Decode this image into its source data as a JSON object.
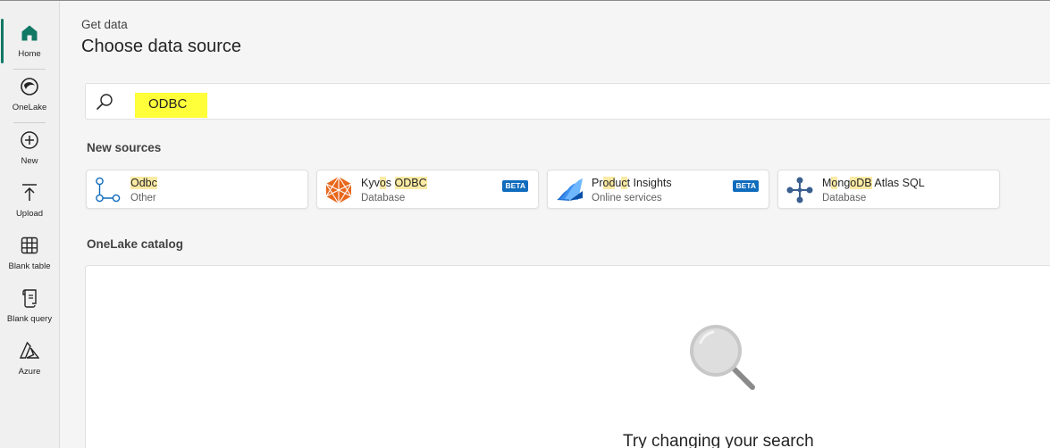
{
  "sidebar": {
    "items": [
      {
        "label": "Home",
        "icon": "home-icon",
        "active": true
      },
      {
        "label": "OneLake",
        "icon": "onelake-icon"
      },
      {
        "label": "New",
        "icon": "plus-circle-icon"
      },
      {
        "label": "Upload",
        "icon": "upload-icon"
      },
      {
        "label": "Blank table",
        "icon": "table-icon"
      },
      {
        "label": "Blank query",
        "icon": "query-icon"
      },
      {
        "label": "Azure",
        "icon": "azure-icon"
      }
    ]
  },
  "header": {
    "breadcrumb": "Get data",
    "title": "Choose data source"
  },
  "search": {
    "value": "ODBC",
    "highlight_color": "#ffff3a"
  },
  "new_sources": {
    "heading": "New sources",
    "cards": [
      {
        "name_parts": [
          [
            "Odbc",
            true
          ]
        ],
        "category": "Other",
        "badge": ""
      },
      {
        "name_parts": [
          [
            "Kyv",
            false
          ],
          [
            "o",
            true
          ],
          [
            "s ",
            false
          ],
          [
            "ODBC",
            true
          ]
        ],
        "category": "Database",
        "badge": "BETA"
      },
      {
        "name_parts": [
          [
            "Pr",
            false
          ],
          [
            "od",
            true
          ],
          [
            "u",
            false
          ],
          [
            "c",
            true
          ],
          [
            "t Insights",
            false
          ]
        ],
        "category": "Online services",
        "badge": "BETA"
      },
      {
        "name_parts": [
          [
            "M",
            false
          ],
          [
            "o",
            true
          ],
          [
            "ng",
            false
          ],
          [
            "oDB",
            true
          ],
          [
            " Atlas SQL",
            false
          ]
        ],
        "category": "Database",
        "badge": ""
      }
    ]
  },
  "catalog": {
    "heading": "OneLake catalog",
    "empty_message": "Try changing your search"
  },
  "colors": {
    "accent": "#117865",
    "beta_badge": "#0f6cbd",
    "match_highlight": "#fbeaa3"
  }
}
